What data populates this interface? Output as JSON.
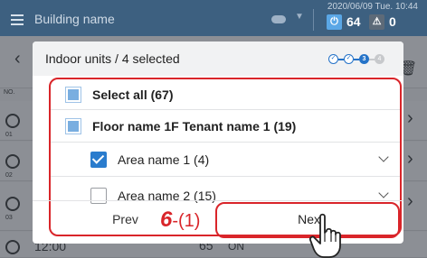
{
  "topbar": {
    "building_name": "Building name",
    "datetime": "2020/06/09 Tue. 10:44",
    "power_count": "64",
    "warning_count": "0",
    "power_glyph": "⏻",
    "warning_glyph": "⚠"
  },
  "background_list": {
    "no_label": "NO.",
    "rows": [
      {
        "number": "01"
      },
      {
        "number": "02"
      },
      {
        "number": "03"
      }
    ],
    "last_row_time": "12:00",
    "last_row_value": "65",
    "last_row_state": "ON"
  },
  "dialog": {
    "title": "Indoor units / 4 selected",
    "steps": [
      "1",
      "2",
      "3",
      "4"
    ],
    "current_step": 3,
    "items": [
      {
        "label": "Select all (67)",
        "state": "partial",
        "bold": true
      },
      {
        "label": "Floor name 1F Tenant name 1 (19)",
        "state": "partial",
        "bold": true
      },
      {
        "label": "Area name 1 (4)",
        "state": "checked",
        "bold": false
      },
      {
        "label": "Area name 2 (15)",
        "state": "empty",
        "bold": false
      }
    ],
    "prev_label": "Prev",
    "next_label": "Next"
  },
  "callout": {
    "step_number": "6",
    "step_suffix": "-(1)"
  },
  "colors": {
    "accent": "#2573c8",
    "highlight": "#d9252a",
    "header_bg": "#3d6080"
  }
}
